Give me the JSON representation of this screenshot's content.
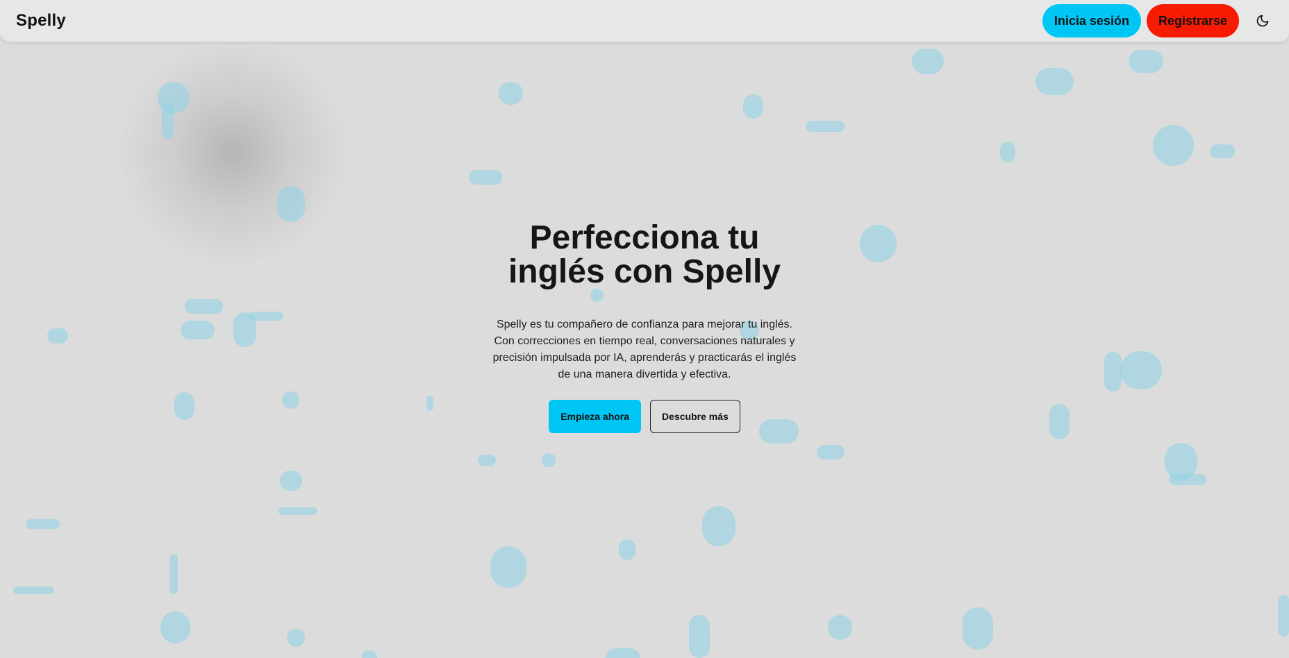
{
  "brand": {
    "name": "Spelly"
  },
  "nav": {
    "login_label": "Inicia sesión",
    "signup_label": "Registrarse",
    "theme_icon": "moon-icon"
  },
  "hero": {
    "title_line1": "Perfecciona tu",
    "title_line2": "inglés con Spelly",
    "description": "Spelly es tu compañero de confianza para mejorar tu inglés. Con correcciones en tiempo real, conversaciones naturales y precisión impulsada por IA, aprenderás y practicarás el inglés de una manera divertida y efectiva.",
    "primary_cta": "Empieza ahora",
    "secondary_cta": "Descubre más"
  },
  "colors": {
    "accent_blue": "#00c6f5",
    "accent_red": "#f71b04",
    "background": "#dcdcdc",
    "navbar": "#e6e7e7",
    "bubble": "#96d2e4"
  }
}
